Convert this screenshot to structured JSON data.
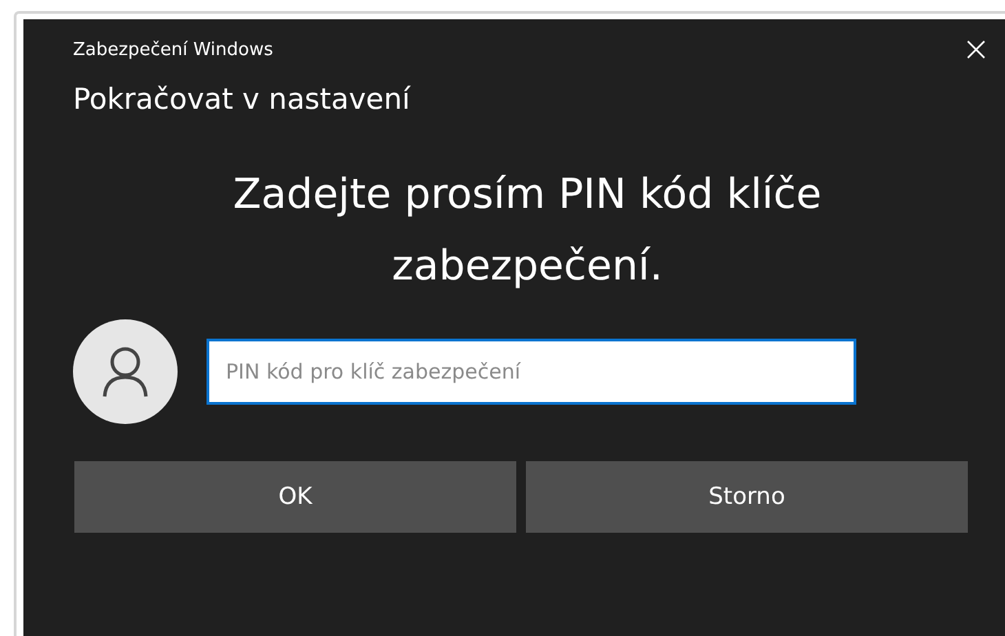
{
  "window": {
    "title": "Zabezpečení Windows"
  },
  "heading": "Pokračovat v nastavení",
  "message": "Zadejte prosím PIN kód klíče zabezpečení.",
  "pin_field": {
    "placeholder": "PIN kód pro klíč zabezpečení"
  },
  "buttons": [
    {
      "label": "OK"
    },
    {
      "label": "Storno"
    }
  ]
}
